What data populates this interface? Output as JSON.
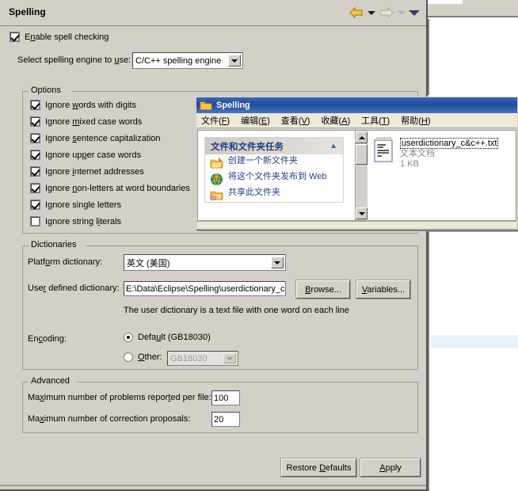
{
  "dialog": {
    "title": "Spelling",
    "nav": {
      "back_icon": "back-arrow-icon",
      "back_menu_icon": "chevron-down-icon",
      "forward_icon": "forward-arrow-icon",
      "forward_menu_icon": "chevron-down-icon",
      "menu_icon": "chevron-down-icon"
    },
    "enable_spell_checking": {
      "label_pre": "E",
      "label_underlined": "n",
      "label_post": "able spell checking",
      "checked": true
    },
    "engine": {
      "label_pre": "Select spelling engine to ",
      "label_underlined": "u",
      "label_post": "se:",
      "value": "C/C++ spelling engine"
    },
    "options": {
      "legend": "Options",
      "items": [
        {
          "pre": "Ignore ",
          "u": "w",
          "post": "ords with digits",
          "checked": true
        },
        {
          "pre": "Ignore ",
          "u": "m",
          "post": "ixed case words",
          "checked": true
        },
        {
          "pre": "Ignore ",
          "u": "s",
          "post": "entence capitalization",
          "checked": true
        },
        {
          "pre": "Ignore up",
          "u": "p",
          "post": "er case words",
          "checked": true
        },
        {
          "pre": "Ignore ",
          "u": "i",
          "post": "nternet addresses",
          "checked": true
        },
        {
          "pre": "Ignore ",
          "u": "n",
          "post": "on-letters at word boundaries",
          "checked": true
        },
        {
          "pre": "I",
          "u": "g",
          "post": "nore single letters",
          "checked": true
        },
        {
          "pre": "Ignore string l",
          "u": "i",
          "post": "terals",
          "checked": false
        }
      ]
    },
    "dictionaries": {
      "legend": "Dictionaries",
      "platform_label_pre": "Platf",
      "platform_label_u": "o",
      "platform_label_post": "rm dictionary:",
      "platform_value": "英文 (美国)",
      "user_label_pre": "Use",
      "user_label_u": "r",
      "user_label_post": " defined dictionary:",
      "user_value": "E:\\Data\\Eclipse\\Spelling\\userdictionary_c&",
      "browse_pre": "",
      "browse_u": "B",
      "browse_post": "rowse...",
      "variables_pre": "",
      "variables_u": "V",
      "variables_post": "ariables...",
      "hint": "The user dictionary is a text file with one word on each line",
      "encoding_label_pre": "En",
      "encoding_label_u": "c",
      "encoding_label_post": "oding:",
      "default_pre": "Defa",
      "default_u": "u",
      "default_post": "lt (GB18030)",
      "default_selected": true,
      "other_pre": "",
      "other_u": "O",
      "other_post": "ther:",
      "other_selected": false,
      "other_value": "GB18030"
    },
    "advanced": {
      "legend": "Advanced",
      "max_problems_pre": "Ma",
      "max_problems_u": "x",
      "max_problems_mid": "imum number of problems repor",
      "max_problems_u2": "t",
      "max_problems_post": "ed per file:",
      "max_problems_value": "100",
      "max_proposals_pre": "Ma",
      "max_proposals_u": "x",
      "max_proposals_post": "imum number of correction proposals:",
      "max_proposals_value": "20"
    },
    "footer": {
      "restore_pre": "Restore ",
      "restore_u": "D",
      "restore_post": "efaults",
      "apply_pre": "",
      "apply_u": "A",
      "apply_post": "pply"
    }
  },
  "explorer": {
    "title": "Spelling",
    "folder_icon": "folder-icon",
    "menu": [
      {
        "label": "文件",
        "key": "F"
      },
      {
        "label": "编辑",
        "key": "E"
      },
      {
        "label": "查看",
        "key": "V"
      },
      {
        "label": "收藏",
        "key": "A"
      },
      {
        "label": "工具",
        "key": "T"
      },
      {
        "label": "帮助",
        "key": "H"
      }
    ],
    "task_panel": {
      "title": "文件和文件夹任务",
      "collapse_icon": "chevron-up-icon",
      "items": [
        {
          "label": "创建一个新文件夹",
          "icon": "new-folder-icon"
        },
        {
          "label": "将这个文件夹发布到 Web",
          "icon": "publish-to-web-icon"
        },
        {
          "label": "共享此文件夹",
          "icon": "share-folder-icon"
        }
      ]
    },
    "scrollbar": {
      "up_icon": "scroll-up-icon",
      "down_icon": "scroll-down-icon"
    },
    "file": {
      "icon": "text-document-icon",
      "name": "userdictionary_c&c++.txt",
      "type": "文本文档",
      "size": "1 KB"
    }
  },
  "colors": {
    "dialog_bg": "#d4d0c8",
    "titlebar_blue": "#1f4a9e",
    "link_blue": "#21418a",
    "accent_gold": "#e8b023"
  }
}
